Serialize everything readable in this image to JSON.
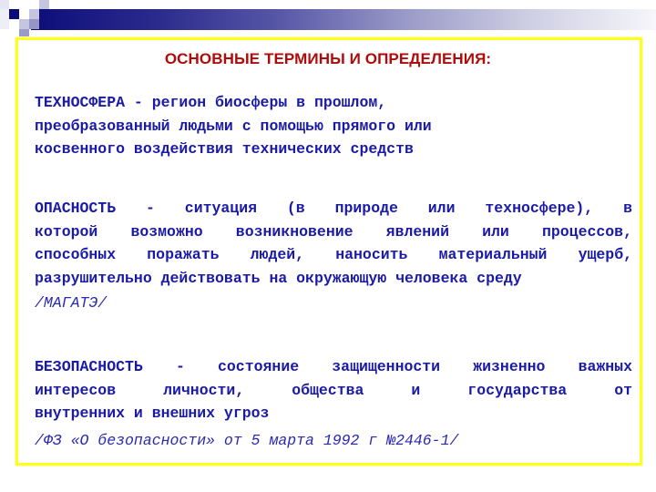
{
  "header": {
    "decoration": "gradient-bar-with-squares",
    "colors": {
      "bar_start": "#0d0d7a",
      "bar_end": "#f6f6fb",
      "frame": "#ffff1a",
      "title": "#b00a0a",
      "body_text": "#1a1aa8"
    }
  },
  "title": "ОСНОВНЫЕ ТЕРМИНЫ И ОПРЕДЕЛЕНИЯ:",
  "terms": [
    {
      "lines": [
        "ТЕХНОСФЕРА - регион биосферы в прошлом,",
        "преобразованный людьми с помощью прямого или",
        "косвенного воздействия технических средств"
      ],
      "source": ""
    },
    {
      "lines": [
        "ОПАСНОСТЬ - ситуация (в природе или техносфере), в",
        "которой возможно возникновение явлений или процессов,",
        "способных поражать людей, наносить материальный ущерб,",
        "разрушительно действовать на окружающую человека среду"
      ],
      "source": "/МАГАТЭ/"
    },
    {
      "lines": [
        "БЕЗОПАСНОСТЬ - состояние защищенности жизненно важных",
        "интересов личности, общества и государства от",
        "внутренних и внешних угроз"
      ],
      "source": "/ФЗ «О безопасности» от 5 марта 1992 г №2446-1/"
    }
  ]
}
